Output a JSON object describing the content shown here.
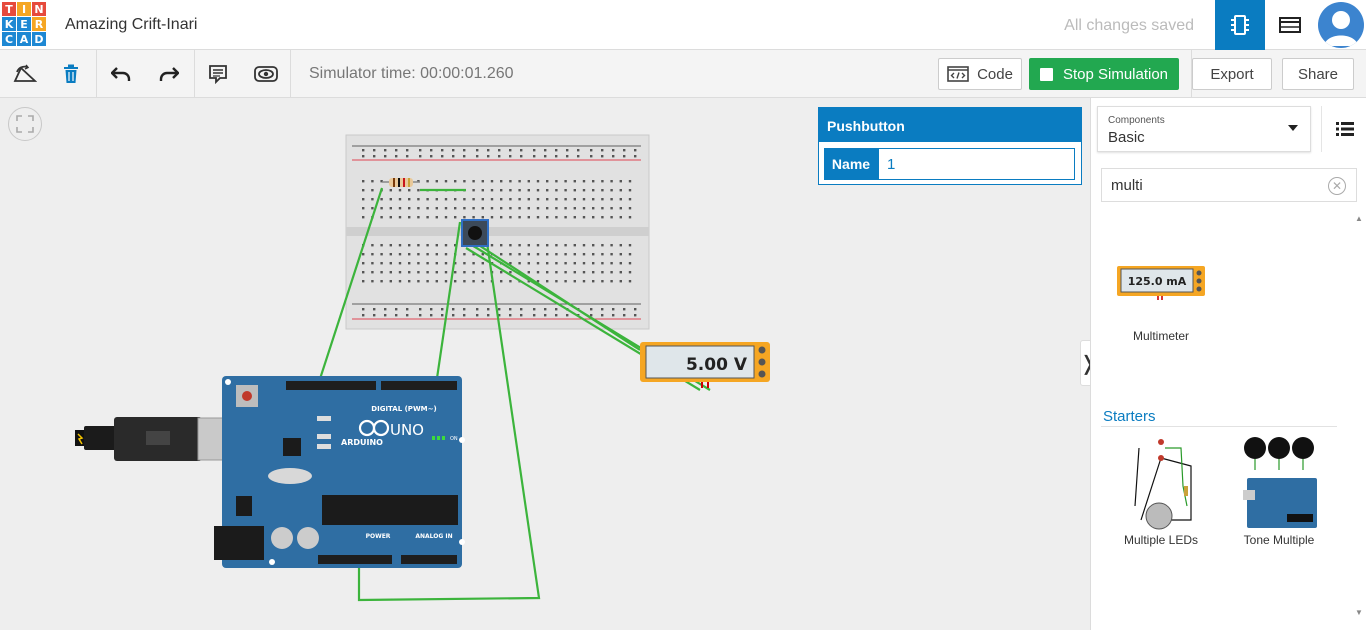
{
  "app": {
    "logo_letters": [
      "T",
      "I",
      "N",
      "K",
      "E",
      "R",
      "C",
      "A",
      "D"
    ],
    "project_name": "Amazing Crift-Inari",
    "save_status": "All changes saved"
  },
  "toolbar": {
    "simulator_time": "Simulator time: 00:00:01.260",
    "code_label": "Code",
    "stop_label": "Stop Simulation",
    "export_label": "Export",
    "share_label": "Share"
  },
  "inspector": {
    "title": "Pushbutton",
    "name_label": "Name",
    "name_value": "1"
  },
  "circuit": {
    "voltmeter_reading": "5.00 V",
    "arduino_brand": "ARDUINO",
    "arduino_model": "UNO",
    "digital_label": "DIGITAL (PWM~)",
    "power_label": "POWER",
    "analog_label": "ANALOG IN",
    "on_label": "ON"
  },
  "panel": {
    "components_label": "Components",
    "components_value": "Basic",
    "search_value": "multi",
    "results": [
      {
        "label": "Multimeter",
        "reading": "125.0 mA"
      }
    ],
    "starters_label": "Starters",
    "starters": [
      {
        "label": "Multiple LEDs"
      },
      {
        "label": "Tone Multiple"
      }
    ]
  },
  "colors": {
    "accent": "#0a7cc1",
    "stop_green": "#22a850",
    "wire_green": "#3cb43c",
    "arduino_blue": "#2f6ea3",
    "meter_orange": "#f5a623",
    "logo_red": "#e64a3c",
    "logo_orange": "#f5a623",
    "logo_blue": "#1e88d3"
  },
  "icons": [
    "logo",
    "circuit-view-icon",
    "table-view-icon",
    "avatar",
    "rotate-icon",
    "delete-icon",
    "undo-icon",
    "redo-icon",
    "notes-icon",
    "visibility-icon",
    "code-icon",
    "fit-view-icon",
    "list-view-icon",
    "clear-search-icon",
    "panel-collapse-icon"
  ]
}
